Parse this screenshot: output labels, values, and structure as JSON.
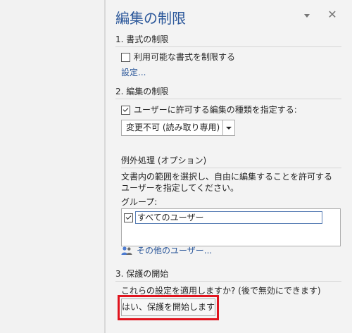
{
  "pane": {
    "title": "編集の制限",
    "close_glyph": "✕"
  },
  "formatting": {
    "heading": "1. 書式の制限",
    "checkbox_label": "利用可能な書式を制限する",
    "checked": false,
    "settings_link": "設定..."
  },
  "editing": {
    "heading": "2. 編集の制限",
    "checkbox_label": "ユーザーに許可する編集の種類を指定する:",
    "checked": true,
    "dropdown_value": "変更不可 (読み取り専用)"
  },
  "exceptions": {
    "heading": "例外処理 (オプション)",
    "description": "文書内の範囲を選択し、自由に編集することを許可するユーザーを指定してください。",
    "groups_label": "グループ:",
    "groups": [
      {
        "label": "すべてのユーザー",
        "checked": true
      }
    ],
    "more_users_link": "その他のユーザー..."
  },
  "enforcement": {
    "heading": "3. 保護の開始",
    "prompt": "これらの設定を適用しますか? (後で無効にできます)",
    "start_button": "はい、保護を開始します"
  },
  "icons": {
    "menu": "triangle-down-icon",
    "close": "close-icon",
    "dropdown": "chevron-down-icon",
    "users": "users-icon",
    "checkbox": "check-icon"
  },
  "colors": {
    "accent": "#2b579a",
    "highlight": "#e0141e",
    "users_icon": "#4c7bd1"
  }
}
